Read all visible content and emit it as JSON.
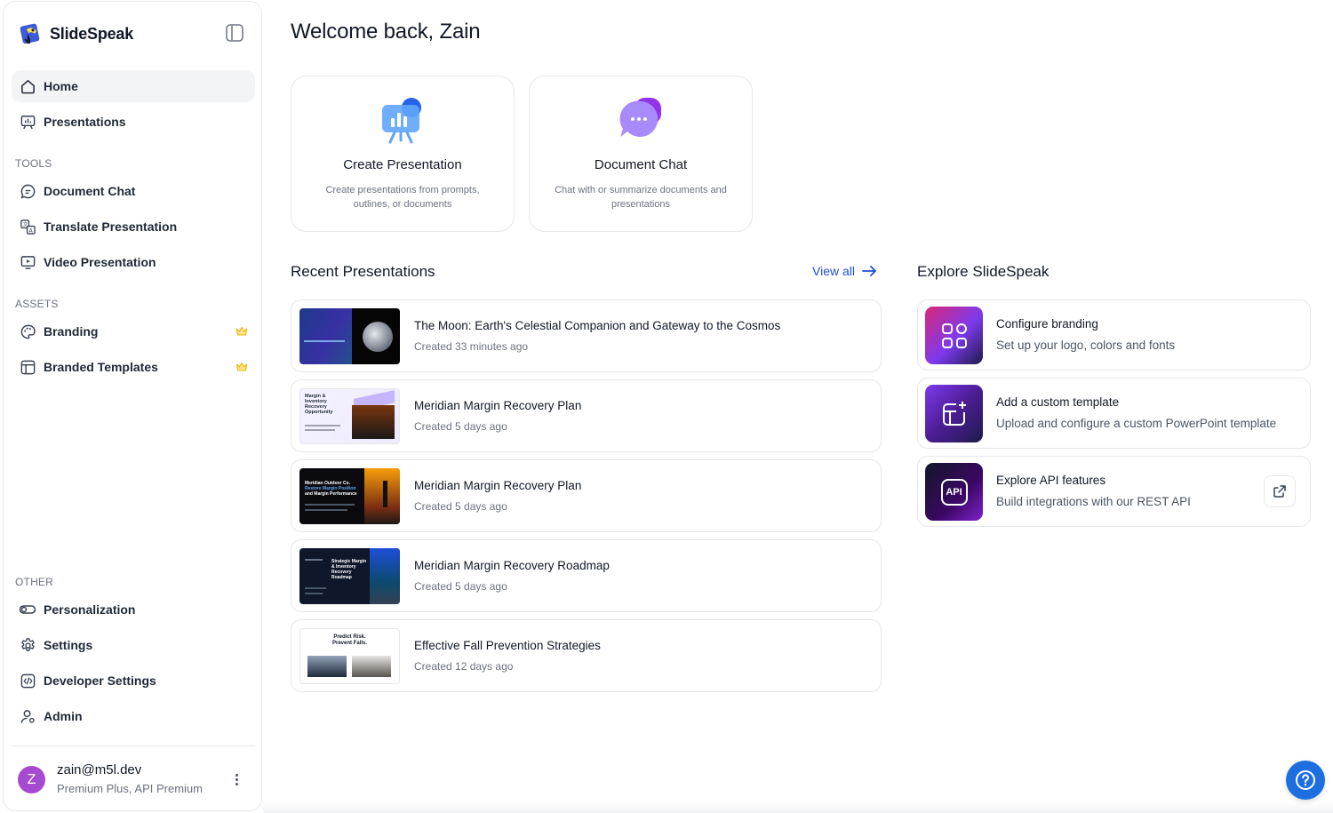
{
  "brand": {
    "name": "SlideSpeak",
    "logo_icon": "parrot-logo"
  },
  "sidebar": {
    "main_items": [
      {
        "label": "Home",
        "icon": "home-icon",
        "active": true
      },
      {
        "label": "Presentations",
        "icon": "presentation-icon"
      }
    ],
    "tools_label": "TOOLS",
    "tools_items": [
      {
        "label": "Document Chat",
        "icon": "chat-icon"
      },
      {
        "label": "Translate Presentation",
        "icon": "translate-icon"
      },
      {
        "label": "Video Presentation",
        "icon": "video-icon"
      }
    ],
    "assets_label": "ASSETS",
    "assets_items": [
      {
        "label": "Branding",
        "icon": "palette-icon",
        "premium": true
      },
      {
        "label": "Branded Templates",
        "icon": "template-icon",
        "premium": true
      }
    ],
    "other_label": "OTHER",
    "other_items": [
      {
        "label": "Personalization",
        "icon": "toggle-icon"
      },
      {
        "label": "Settings",
        "icon": "gear-icon"
      },
      {
        "label": "Developer Settings",
        "icon": "code-icon"
      },
      {
        "label": "Admin",
        "icon": "user-admin-icon"
      }
    ],
    "user": {
      "avatar_letter": "Z",
      "email": "zain@m5l.dev",
      "plan": "Premium Plus, API Premium",
      "avatar_color": "#a64bd1"
    }
  },
  "main": {
    "welcome": "Welcome back, Zain",
    "tool_cards": [
      {
        "title": "Create Presentation",
        "desc": "Create presentations from prompts, outlines, or documents"
      },
      {
        "title": "Document Chat",
        "desc": "Chat with or summarize documents and presentations"
      }
    ],
    "recent": {
      "title": "Recent Presentations",
      "view_all": "View all",
      "items": [
        {
          "title": "The Moon: Earth's Celestial Companion and Gateway to the Cosmos",
          "date": "Created 33 minutes ago"
        },
        {
          "title": "Meridian Margin Recovery Plan",
          "date": "Created 5 days ago"
        },
        {
          "title": "Meridian Margin Recovery Plan",
          "date": "Created 5 days ago"
        },
        {
          "title": "Meridian Margin Recovery Roadmap",
          "date": "Created 5 days ago"
        },
        {
          "title": "Effective Fall Prevention Strategies",
          "date": "Created 12 days ago"
        }
      ],
      "thumb_texts": {
        "t2": [
          "Margin &",
          "Inventory",
          "Recovery",
          "Opportunity"
        ],
        "t3": [
          "Meridian Outdoor Co.",
          "Restore Margin Position",
          "and Margin Performance"
        ],
        "t4": [
          "Strategic Margin",
          "& Inventory",
          "Recovery",
          "Roadmap"
        ],
        "t5": [
          "Predict Risk.",
          "Prevent Falls."
        ]
      }
    },
    "explore": {
      "title": "Explore SlideSpeak",
      "items": [
        {
          "title": "Configure branding",
          "desc": "Set up your logo, colors and fonts"
        },
        {
          "title": "Add a custom template",
          "desc": "Upload and configure a custom PowerPoint template"
        },
        {
          "title": "Explore API features",
          "desc": "Build integrations with our REST API",
          "icon_text": "API"
        }
      ]
    }
  },
  "colors": {
    "accent": "#1d6fe0",
    "link": "#1d4ed8",
    "premium": "#eab308"
  }
}
